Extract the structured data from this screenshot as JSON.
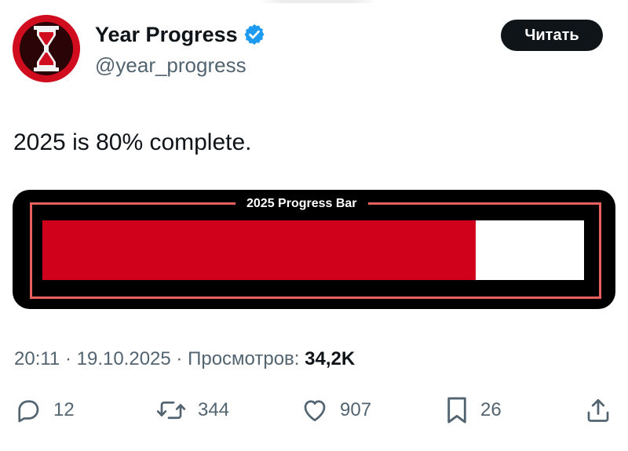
{
  "tweet": {
    "display_name": "Year Progress",
    "handle": "@year_progress",
    "follow_label": "Читать",
    "text": "2025 is 80% complete.",
    "media": {
      "title": "2025 Progress Bar",
      "progress_fraction": 0.8,
      "colors": {
        "background": "#000000",
        "frame": "#e8615f",
        "fill": "#d0021b",
        "empty": "#ffffff"
      }
    },
    "meta": {
      "time": "20:11",
      "separator": "·",
      "date": "19.10.2025",
      "views_label": "Просмотров:",
      "views_count": "34,2K"
    },
    "actions": {
      "replies": {
        "icon": "reply-icon",
        "count": "12"
      },
      "reposts": {
        "icon": "repost-icon",
        "count": "344"
      },
      "likes": {
        "icon": "heart-icon",
        "count": "907"
      },
      "bookmarks": {
        "icon": "bookmark-icon",
        "count": "26"
      },
      "share": {
        "icon": "share-icon"
      }
    }
  },
  "colors": {
    "accent_verified": "#1d9bf0",
    "text_primary": "#0f1419",
    "text_secondary": "#536471",
    "avatar_bg": "#d00d1f"
  }
}
